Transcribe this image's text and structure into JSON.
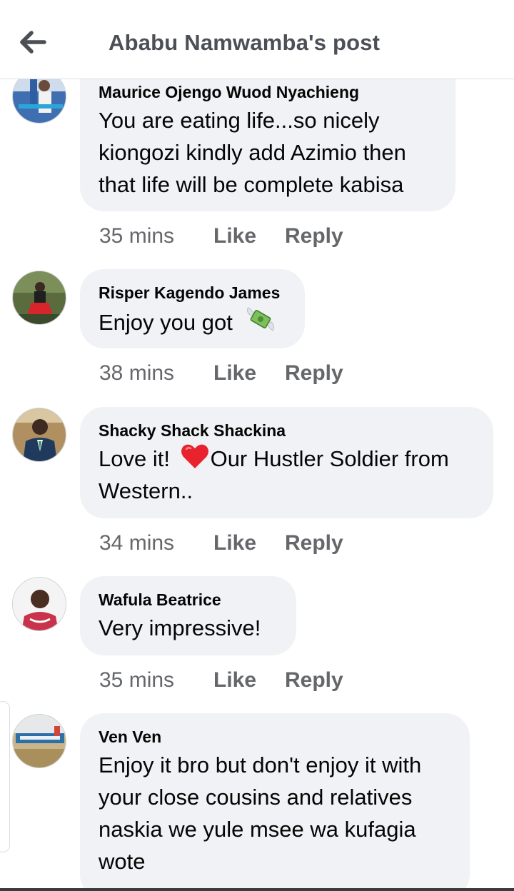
{
  "header": {
    "title": "Ababu Namwamba's post"
  },
  "comments": [
    {
      "name": "Maurice Ojengo Wuod Nyachieng",
      "lines": [
        "You are eating life...so nicely",
        "kiongozi kindly add Azimio then",
        "that life will be complete kabisa"
      ],
      "time": "35 mins",
      "like": "Like",
      "reply": "Reply"
    },
    {
      "name": "Risper Kagendo James",
      "lines": [
        "Enjoy you got"
      ],
      "emoji": "money-with-wings-icon",
      "time": "38 mins",
      "like": "Like",
      "reply": "Reply"
    },
    {
      "name": "Shacky Shack Shackina",
      "lines": [
        "Love it!",
        "Our Hustler Soldier from",
        "Western.."
      ],
      "emoji": "red-heart-icon",
      "time": "34 mins",
      "like": "Like",
      "reply": "Reply"
    },
    {
      "name": "Wafula Beatrice",
      "lines": [
        "Very impressive!"
      ],
      "time": "35 mins",
      "like": "Like",
      "reply": "Reply"
    },
    {
      "name": "Ven Ven",
      "lines": [
        "Enjoy it bro but don't enjoy it with",
        "your close cousins and relatives",
        "naskia we yule msee wa kufagia",
        "wote"
      ]
    }
  ],
  "colors": {
    "bubble": "#f0f2f5",
    "meta": "#65676b",
    "title": "#4b4f56"
  }
}
